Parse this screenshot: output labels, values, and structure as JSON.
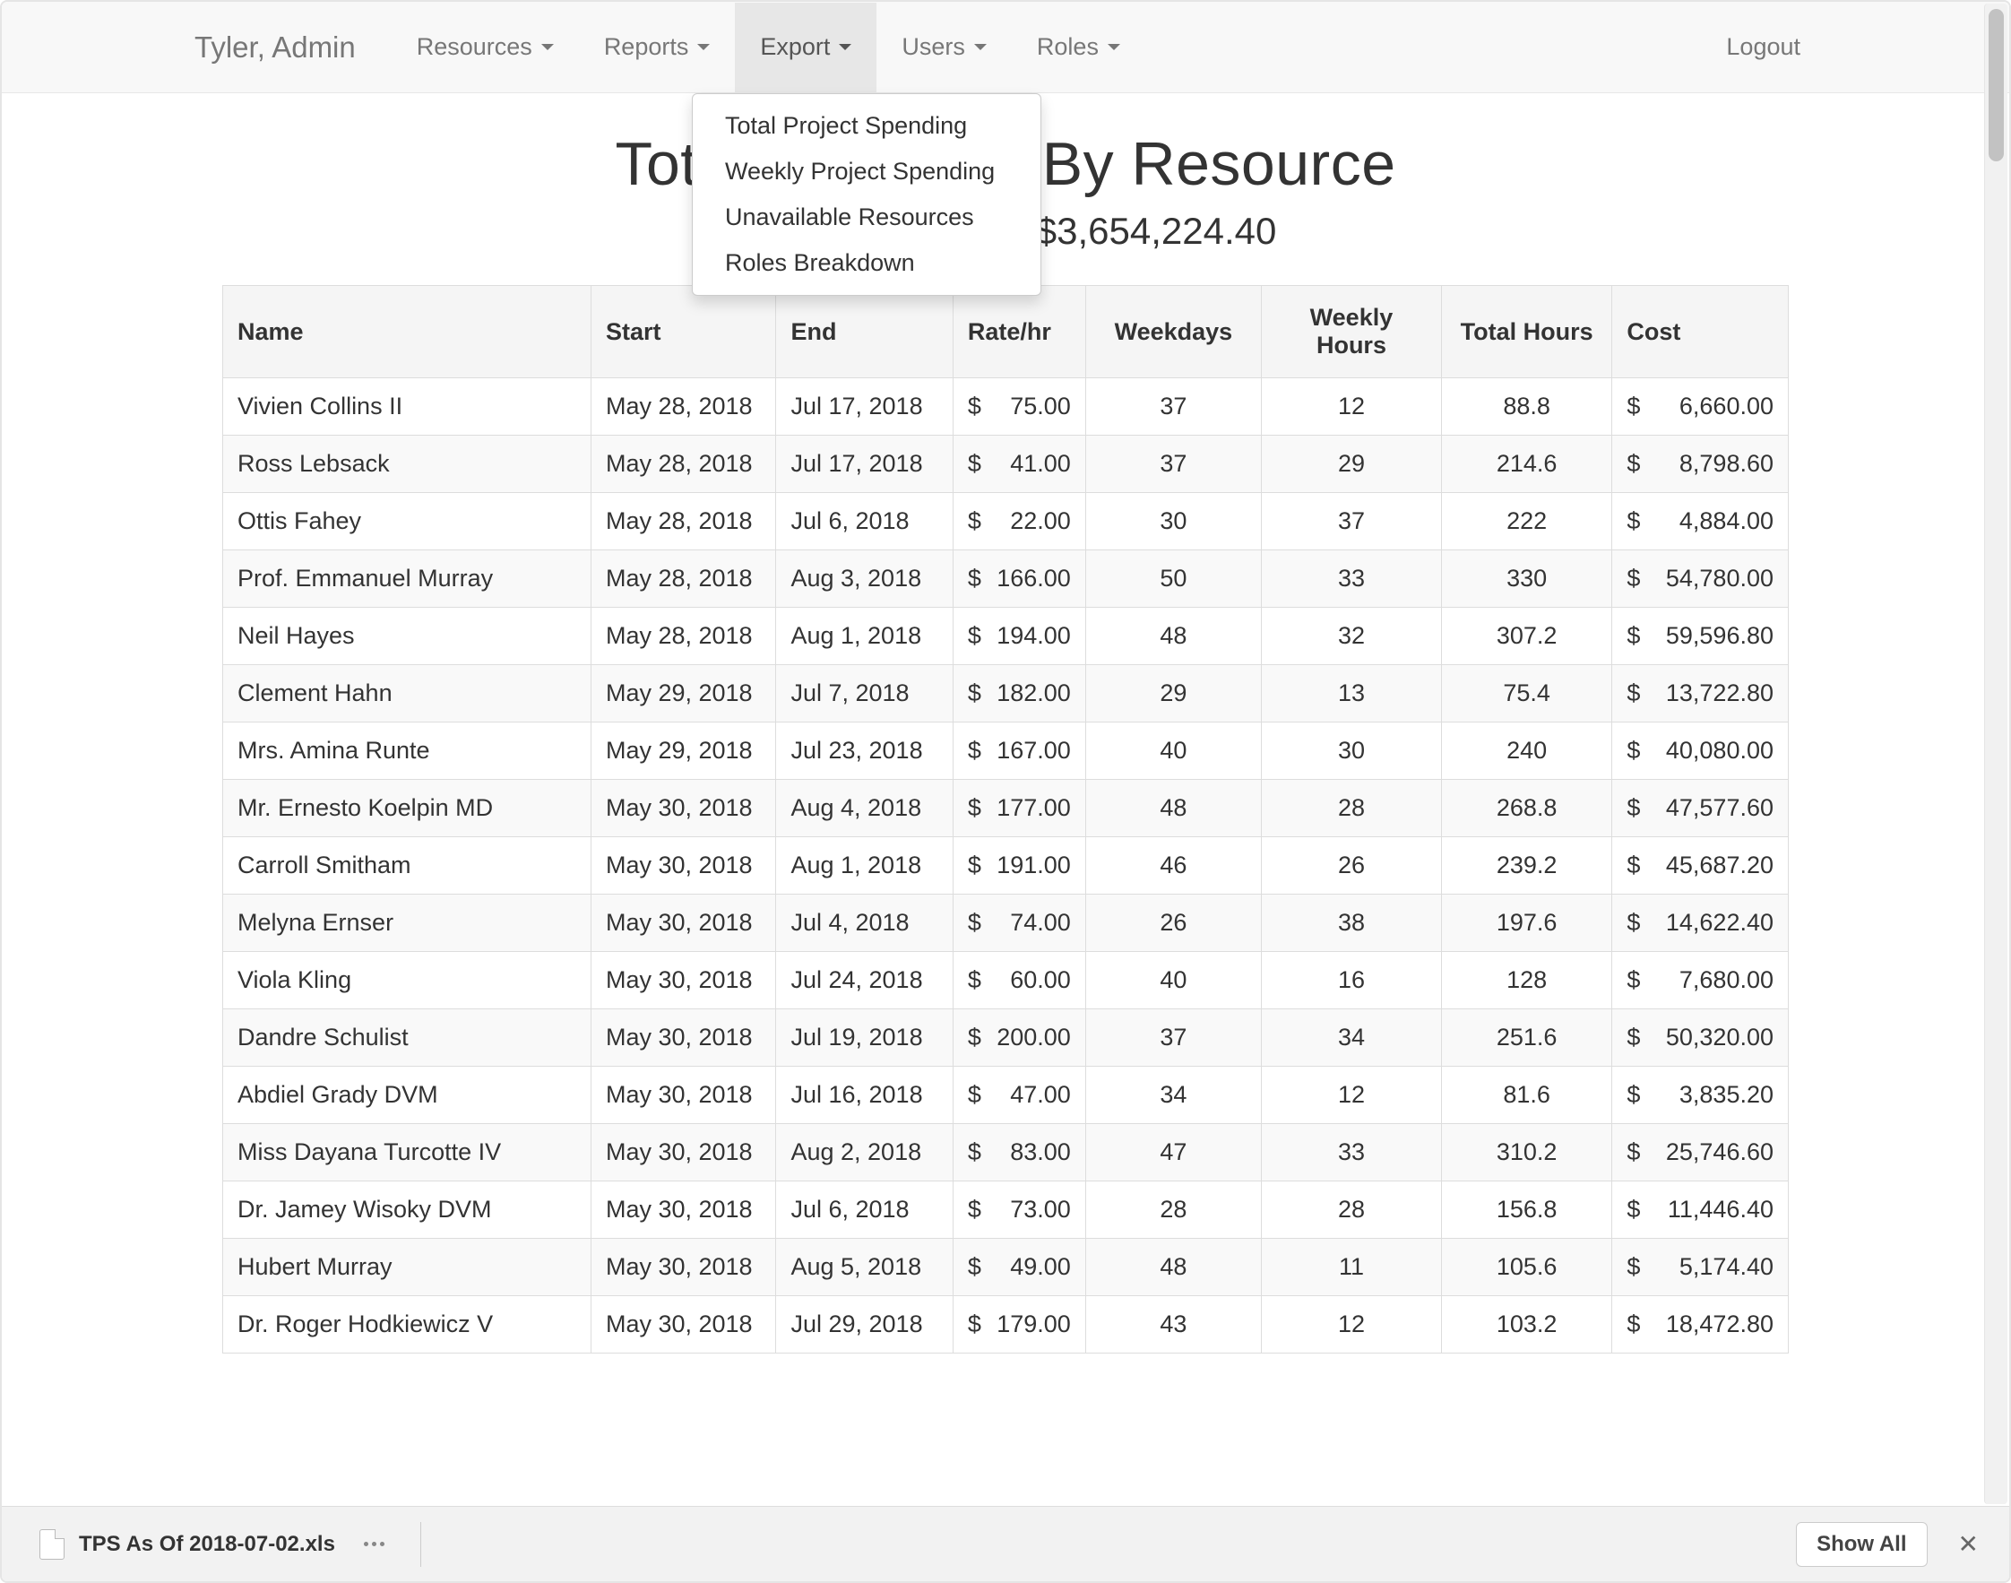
{
  "brand": "Tyler, Admin",
  "nav": {
    "items": [
      {
        "label": "Resources",
        "active": false
      },
      {
        "label": "Reports",
        "active": false
      },
      {
        "label": "Export",
        "active": true
      },
      {
        "label": "Users",
        "active": false
      },
      {
        "label": "Roles",
        "active": false
      }
    ],
    "logout": "Logout"
  },
  "dropdown": [
    "Total Project Spending",
    "Weekly Project Spending",
    "Unavailable Resources",
    "Roles Breakdown"
  ],
  "page": {
    "title": "Total Spending By Resource",
    "subtitle": "As of Jul 2, 2018, $3,654,224.40"
  },
  "table": {
    "headers": {
      "name": "Name",
      "start": "Start",
      "end": "End",
      "rate": "Rate/hr",
      "weekdays": "Weekdays",
      "weekly_hours": "Weekly Hours",
      "total_hours": "Total Hours",
      "cost": "Cost"
    },
    "rows": [
      {
        "name": "Vivien Collins II",
        "start": "May 28, 2018",
        "end": "Jul 17, 2018",
        "rate": "75.00",
        "weekdays": "37",
        "weekly": "12",
        "total": "88.8",
        "cost": "6,660.00"
      },
      {
        "name": "Ross Lebsack",
        "start": "May 28, 2018",
        "end": "Jul 17, 2018",
        "rate": "41.00",
        "weekdays": "37",
        "weekly": "29",
        "total": "214.6",
        "cost": "8,798.60"
      },
      {
        "name": "Ottis Fahey",
        "start": "May 28, 2018",
        "end": "Jul 6, 2018",
        "rate": "22.00",
        "weekdays": "30",
        "weekly": "37",
        "total": "222",
        "cost": "4,884.00"
      },
      {
        "name": "Prof. Emmanuel Murray",
        "start": "May 28, 2018",
        "end": "Aug 3, 2018",
        "rate": "166.00",
        "weekdays": "50",
        "weekly": "33",
        "total": "330",
        "cost": "54,780.00"
      },
      {
        "name": "Neil Hayes",
        "start": "May 28, 2018",
        "end": "Aug 1, 2018",
        "rate": "194.00",
        "weekdays": "48",
        "weekly": "32",
        "total": "307.2",
        "cost": "59,596.80"
      },
      {
        "name": "Clement Hahn",
        "start": "May 29, 2018",
        "end": "Jul 7, 2018",
        "rate": "182.00",
        "weekdays": "29",
        "weekly": "13",
        "total": "75.4",
        "cost": "13,722.80"
      },
      {
        "name": "Mrs. Amina Runte",
        "start": "May 29, 2018",
        "end": "Jul 23, 2018",
        "rate": "167.00",
        "weekdays": "40",
        "weekly": "30",
        "total": "240",
        "cost": "40,080.00"
      },
      {
        "name": "Mr. Ernesto Koelpin MD",
        "start": "May 30, 2018",
        "end": "Aug 4, 2018",
        "rate": "177.00",
        "weekdays": "48",
        "weekly": "28",
        "total": "268.8",
        "cost": "47,577.60"
      },
      {
        "name": "Carroll Smitham",
        "start": "May 30, 2018",
        "end": "Aug 1, 2018",
        "rate": "191.00",
        "weekdays": "46",
        "weekly": "26",
        "total": "239.2",
        "cost": "45,687.20"
      },
      {
        "name": "Melyna Ernser",
        "start": "May 30, 2018",
        "end": "Jul 4, 2018",
        "rate": "74.00",
        "weekdays": "26",
        "weekly": "38",
        "total": "197.6",
        "cost": "14,622.40"
      },
      {
        "name": "Viola Kling",
        "start": "May 30, 2018",
        "end": "Jul 24, 2018",
        "rate": "60.00",
        "weekdays": "40",
        "weekly": "16",
        "total": "128",
        "cost": "7,680.00"
      },
      {
        "name": "Dandre Schulist",
        "start": "May 30, 2018",
        "end": "Jul 19, 2018",
        "rate": "200.00",
        "weekdays": "37",
        "weekly": "34",
        "total": "251.6",
        "cost": "50,320.00"
      },
      {
        "name": "Abdiel Grady DVM",
        "start": "May 30, 2018",
        "end": "Jul 16, 2018",
        "rate": "47.00",
        "weekdays": "34",
        "weekly": "12",
        "total": "81.6",
        "cost": "3,835.20"
      },
      {
        "name": "Miss Dayana Turcotte IV",
        "start": "May 30, 2018",
        "end": "Aug 2, 2018",
        "rate": "83.00",
        "weekdays": "47",
        "weekly": "33",
        "total": "310.2",
        "cost": "25,746.60"
      },
      {
        "name": "Dr. Jamey Wisoky DVM",
        "start": "May 30, 2018",
        "end": "Jul 6, 2018",
        "rate": "73.00",
        "weekdays": "28",
        "weekly": "28",
        "total": "156.8",
        "cost": "11,446.40"
      },
      {
        "name": "Hubert Murray",
        "start": "May 30, 2018",
        "end": "Aug 5, 2018",
        "rate": "49.00",
        "weekdays": "48",
        "weekly": "11",
        "total": "105.6",
        "cost": "5,174.40"
      },
      {
        "name": "Dr. Roger Hodkiewicz V",
        "start": "May 30, 2018",
        "end": "Jul 29, 2018",
        "rate": "179.00",
        "weekdays": "43",
        "weekly": "12",
        "total": "103.2",
        "cost": "18,472.80"
      }
    ]
  },
  "download_bar": {
    "filename": "TPS As Of 2018-07-02.xls",
    "show_all": "Show All"
  },
  "currency": "$"
}
